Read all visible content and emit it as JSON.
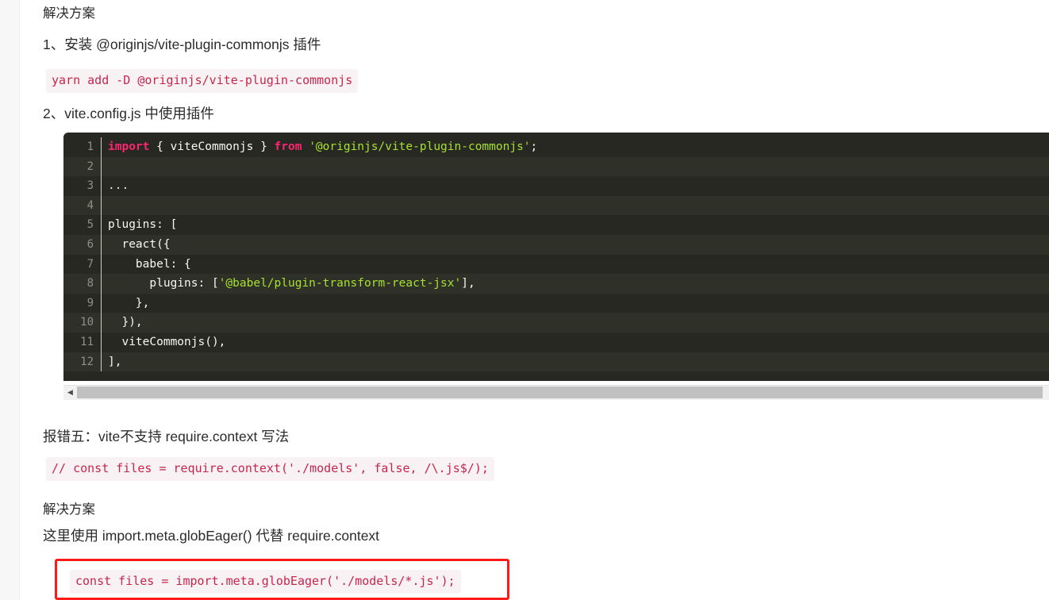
{
  "page": {
    "background": "#ffffff",
    "accent_red": "#fb1b18",
    "inline_code_color": "#c7254e",
    "inline_code_bg": "#f9f2f4",
    "code_block_bg": "#272822"
  },
  "sections": {
    "solution_heading_1": "解决方案",
    "step_1": "1、安装 @originjs/vite-plugin-commonjs 插件",
    "install_command": "yarn add -D @originjs/vite-plugin-commonjs",
    "step_2": "2、vite.config.js 中使用插件",
    "error_five_heading": "报错五：vite不支持  require.context 写法",
    "require_context_snippet": "// const files = require.context('./models', false, /\\.js$/);",
    "solution_heading_2": "解决方案",
    "solution_note": "这里使用 import.meta.globEager() 代替 require.context",
    "glob_eager_snippet": "const files = import.meta.globEager('./models/*.js');"
  },
  "code_block": {
    "language": "javascript",
    "line_numbers": [
      "1",
      "2",
      "3",
      "4",
      "5",
      "6",
      "7",
      "8",
      "9",
      "10",
      "11",
      "12"
    ],
    "lines": [
      {
        "n": "1",
        "segments": [
          {
            "t": "import",
            "c": "kw"
          },
          {
            "t": " { viteCommonjs } ",
            "c": "plain"
          },
          {
            "t": "from",
            "c": "kw"
          },
          {
            "t": " ",
            "c": "plain"
          },
          {
            "t": "'@originjs/vite-plugin-commonjs'",
            "c": "str"
          },
          {
            "t": ";",
            "c": "punct"
          }
        ]
      },
      {
        "n": "2",
        "segments": []
      },
      {
        "n": "3",
        "segments": [
          {
            "t": "...",
            "c": "dim"
          }
        ]
      },
      {
        "n": "4",
        "segments": []
      },
      {
        "n": "5",
        "segments": [
          {
            "t": "plugins: [",
            "c": "plain"
          }
        ]
      },
      {
        "n": "6",
        "segments": [
          {
            "t": "  react({",
            "c": "plain"
          }
        ]
      },
      {
        "n": "7",
        "segments": [
          {
            "t": "    babel: {",
            "c": "plain"
          }
        ]
      },
      {
        "n": "8",
        "segments": [
          {
            "t": "      plugins: [",
            "c": "plain"
          },
          {
            "t": "'@babel/plugin-transform-react-jsx'",
            "c": "str"
          },
          {
            "t": "],",
            "c": "punct"
          }
        ]
      },
      {
        "n": "9",
        "segments": [
          {
            "t": "    },",
            "c": "plain"
          }
        ]
      },
      {
        "n": "10",
        "segments": [
          {
            "t": "  }),",
            "c": "plain"
          }
        ]
      },
      {
        "n": "11",
        "segments": [
          {
            "t": "  viteCommonjs(),",
            "c": "plain"
          }
        ]
      },
      {
        "n": "12",
        "segments": [
          {
            "t": "],",
            "c": "plain"
          }
        ]
      }
    ]
  },
  "scrollbars": {
    "horizontal_left_arrow": "◀",
    "horizontal_right_arrow": "▶"
  }
}
